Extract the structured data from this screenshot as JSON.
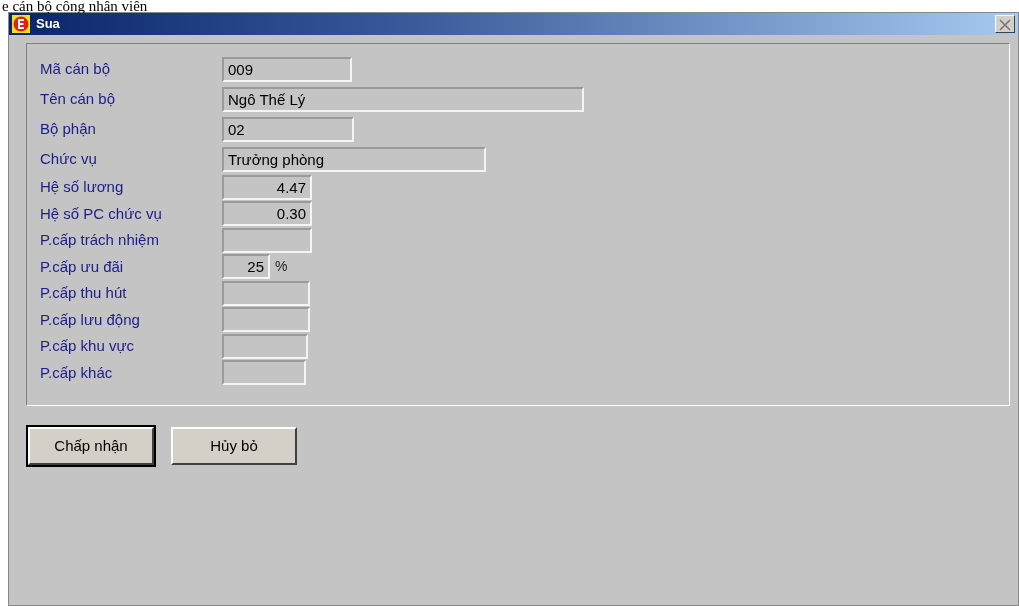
{
  "page_heading": "e cán bộ công nhân viên",
  "window": {
    "title": "Sua"
  },
  "fields": [
    {
      "label": "Mã cán bộ",
      "value": "009",
      "kind": "text"
    },
    {
      "label": "Tên cán bộ",
      "value": "Ngô Thế Lý",
      "kind": "text"
    },
    {
      "label": "Bộ phận",
      "value": "02",
      "kind": "text"
    },
    {
      "label": "Chức vụ",
      "value": "Trưởng phòng",
      "kind": "text"
    },
    {
      "label": "Hệ số lương",
      "value": "4.47",
      "kind": "number"
    },
    {
      "label": "Hệ số PC chức vụ",
      "value": "0.30",
      "kind": "number"
    },
    {
      "label": "P.cấp trách nhiệm",
      "kind": "number"
    },
    {
      "label": "P.cấp ưu đãi",
      "value": "25",
      "kind": "number",
      "unit": "%"
    },
    {
      "label": "P.cấp thu hút",
      "kind": "number"
    },
    {
      "label": "P.cấp lưu động",
      "kind": "number"
    },
    {
      "label": "P.cấp khu vực",
      "kind": "number"
    },
    {
      "label": "P.cấp khác",
      "kind": "number"
    }
  ],
  "buttons": [
    {
      "label": "Chấp nhận",
      "default": true
    },
    {
      "label": "Hủy bỏ",
      "default": false
    }
  ]
}
